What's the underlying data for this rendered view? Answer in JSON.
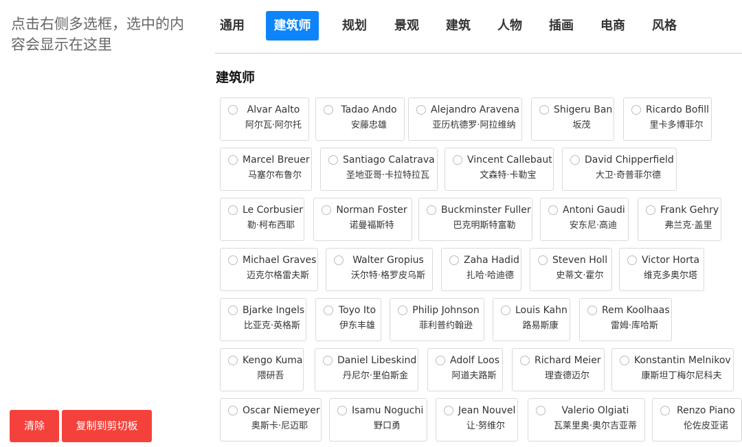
{
  "left": {
    "hint": "点击右侧多选框，选中的内容会显示在这里",
    "clear_label": "清除",
    "copy_label": "复制到剪切板"
  },
  "tabs": [
    "通用",
    "建筑师",
    "规划",
    "景观",
    "建筑",
    "人物",
    "插画",
    "电商",
    "风格"
  ],
  "active_tab": 1,
  "section_title": "建筑师",
  "rows": [
    [
      {
        "en": "Alvar Aalto",
        "zh": "阿尔瓦·阿尔托"
      },
      {
        "en": "Tadao Ando",
        "zh": "安藤忠雄"
      },
      {
        "en": "Alejandro Aravena",
        "zh": "亚历杭德罗·阿拉维纳"
      },
      {
        "en": "Shigeru Ban",
        "zh": "坂茂"
      },
      {
        "en": "Ricardo Bofill",
        "zh": "里卡多博菲尔"
      }
    ],
    [
      {
        "en": "Marcel Breuer",
        "zh": "马塞尔布鲁尔"
      },
      {
        "en": "Santiago Calatrava",
        "zh": "圣地亚哥·卡拉特拉瓦"
      },
      {
        "en": "Vincent Callebaut",
        "zh": "文森特·卡勒宝"
      },
      {
        "en": "David Chipperfield",
        "zh": "大卫·奇普菲尔德"
      }
    ],
    [
      {
        "en": "Le Corbusier",
        "zh": "勒·柯布西耶"
      },
      {
        "en": "Norman Foster",
        "zh": "诺曼福斯特"
      },
      {
        "en": "Buckminster Fuller",
        "zh": "巴克明斯特富勒"
      },
      {
        "en": "Antoni Gaudi",
        "zh": "安东尼·高迪"
      },
      {
        "en": "Frank Gehry",
        "zh": "弗兰克·盖里"
      }
    ],
    [
      {
        "en": "Michael Graves",
        "zh": "迈克尔格雷夫斯"
      },
      {
        "en": "Walter Gropius",
        "zh": "沃尔特·格罗皮乌斯"
      },
      {
        "en": "Zaha Hadid",
        "zh": "扎哈·哈迪德"
      },
      {
        "en": "Steven Holl",
        "zh": "史蒂文·霍尔"
      },
      {
        "en": "Victor Horta",
        "zh": "维克多奥尔塔"
      }
    ],
    [
      {
        "en": "Bjarke Ingels",
        "zh": "比亚克·英格斯"
      },
      {
        "en": "Toyo Ito",
        "zh": "伊东丰雄"
      },
      {
        "en": "Philip Johnson",
        "zh": "菲利普约翰逊"
      },
      {
        "en": "Louis Kahn",
        "zh": "路易斯康"
      },
      {
        "en": "Rem Koolhaas",
        "zh": "雷姆·库哈斯"
      }
    ],
    [
      {
        "en": "Kengo Kuma",
        "zh": "隈研吾"
      },
      {
        "en": "Daniel Libeskind",
        "zh": "丹尼尔·里伯斯金"
      },
      {
        "en": "Adolf Loos",
        "zh": "阿道夫路斯"
      },
      {
        "en": "Richard Meier",
        "zh": "理查德迈尔"
      },
      {
        "en": "Konstantin Melnikov",
        "zh": "康斯坦丁梅尔尼科夫"
      }
    ],
    [
      {
        "en": "Oscar Niemeyer",
        "zh": "奥斯卡·尼迈耶"
      },
      {
        "en": "Isamu Noguchi",
        "zh": "野口勇"
      },
      {
        "en": "Jean Nouvel",
        "zh": "让·努维尔"
      },
      {
        "en": "Valerio Olgiati",
        "zh": "瓦莱里奥·奥尔吉亚蒂"
      },
      {
        "en": "Renzo Piano",
        "zh": "伦佐皮亚诺"
      }
    ]
  ]
}
